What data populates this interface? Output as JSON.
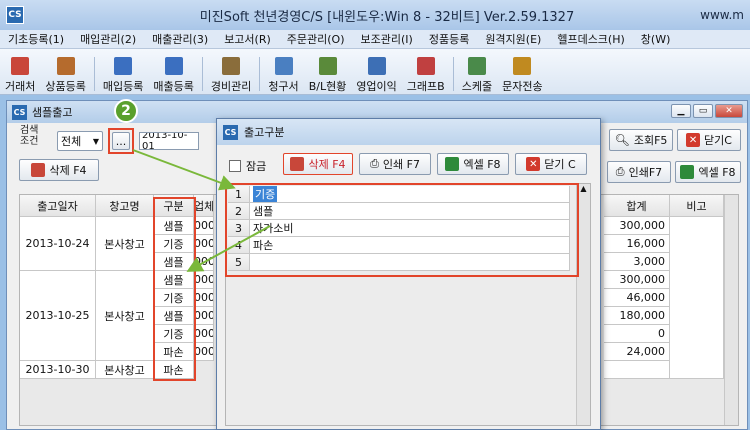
{
  "app": {
    "logo": "CS",
    "title": "미진Soft 천년경영C/S [내윈도우:Win 8 - 32비트] Ver.2.59.1327",
    "title_right": "www.m"
  },
  "menu": [
    "기초등록(1)",
    "매입관리(2)",
    "매출관리(3)",
    "보고서(R)",
    "주문관리(O)",
    "보조관리(I)",
    "정품등록",
    "원격지원(E)",
    "헬프데스크(H)",
    "창(W)"
  ],
  "toolbar": [
    {
      "label": "거래처",
      "icon": "customer-icon",
      "color": "#c9463a"
    },
    {
      "label": "상품등록",
      "icon": "product-box-icon",
      "color": "#b56b2d"
    },
    {
      "label": "매입등록",
      "icon": "purchase-icon",
      "color": "#3b6fc0"
    },
    {
      "label": "매출등록",
      "icon": "sales-icon",
      "color": "#3b6fc0"
    },
    {
      "label": "경비관리",
      "icon": "expense-icon",
      "color": "#8a6d3b"
    },
    {
      "label": "청구서",
      "icon": "invoice-icon",
      "color": "#4a7fc1"
    },
    {
      "label": "B/L현황",
      "icon": "bl-status-icon",
      "color": "#5a8a3a"
    },
    {
      "label": "영업이익",
      "icon": "profit-icon",
      "color": "#3d6fb5"
    },
    {
      "label": "그래프B",
      "icon": "bar-graph-icon",
      "color": "#c04040"
    },
    {
      "label": "스케줄",
      "icon": "schedule-icon",
      "color": "#4a8a4a"
    },
    {
      "label": "문자전송",
      "icon": "sms-icon",
      "color": "#c08a20"
    }
  ],
  "child": {
    "logo": "CS",
    "title": "샘플출고",
    "search_label": "검색\n조건",
    "filter_value": "전체",
    "ellipsis": "...",
    "date_value": "2013-10-01",
    "step_badge": "2",
    "delete_btn": "삭제 F4",
    "search_btn": "조회F5",
    "close_btn": "닫기C",
    "print_btn": "인쇄F7",
    "excel_btn": "엑셀 F8",
    "columns": [
      "출고일자",
      "창고명",
      "구분",
      "업체",
      "합계",
      "비고"
    ],
    "groups": [
      {
        "date": "2013-10-24",
        "warehouse": "본사창고"
      },
      {
        "date": "2013-10-25",
        "warehouse": "본사창고"
      },
      {
        "date": "2013-10-30",
        "warehouse": "본사창고"
      }
    ],
    "types": [
      "샘플",
      "기증",
      "샘플",
      "샘플",
      "기증",
      "샘플",
      "기증",
      "파손",
      "파손"
    ],
    "partial": [
      "000",
      "000",
      "000",
      "000",
      "000",
      "000",
      "000",
      "000"
    ],
    "totals": [
      "300,000",
      "16,000",
      "3,000",
      "300,000",
      "46,000",
      "180,000",
      "0",
      "24,000"
    ]
  },
  "dialog": {
    "logo": "CS",
    "title": "출고구분",
    "lock_label": "잠금",
    "delete_btn": "삭제 F4",
    "print_btn": "인쇄 F7",
    "excel_btn": "엑셀 F8",
    "close_btn": "닫기 C",
    "rows": [
      {
        "no": "1",
        "value": "기증"
      },
      {
        "no": "2",
        "value": "샘플"
      },
      {
        "no": "3",
        "value": "자가소비"
      },
      {
        "no": "4",
        "value": "파손"
      },
      {
        "no": "5",
        "value": ""
      }
    ]
  },
  "colors": {
    "accent": "#e2452b",
    "arrow": "#7ab83a",
    "badge": "#5aa02c",
    "selection": "#3b84d6"
  }
}
